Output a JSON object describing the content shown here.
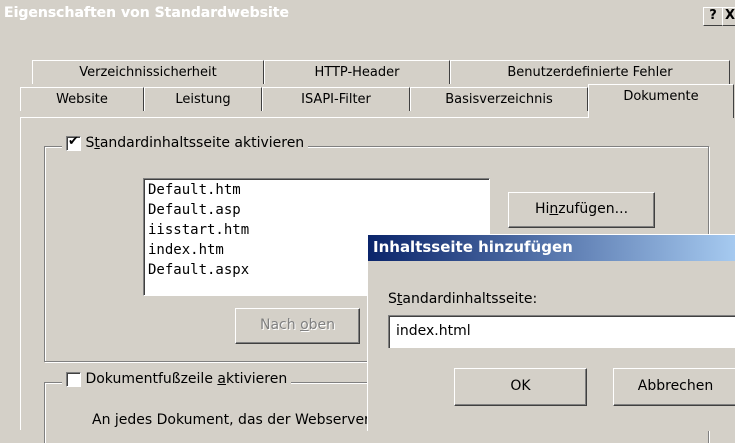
{
  "window": {
    "title": "Eigenschaften von Standardwebsite",
    "help_button": "?",
    "close_button": "X"
  },
  "tabs": {
    "row1": [
      "Verzeichnissicherheit",
      "HTTP-Header",
      "Benutzerdefinierte Fehler"
    ],
    "row2": [
      "Website",
      "Leistung",
      "ISAPI-Filter",
      "Basisverzeichnis",
      "Dokumente"
    ],
    "active": "Dokumente"
  },
  "default_doc": {
    "checkbox_label_pre": "S",
    "checkbox_label_ul": "t",
    "checkbox_label_post": "andardinhaltsseite aktivieren",
    "checked": true,
    "list_items": [
      "Default.htm",
      "Default.asp",
      "iisstart.htm",
      "index.htm",
      "Default.aspx"
    ],
    "add_button_pre": "Hi",
    "add_button_ul": "n",
    "add_button_post": "zufügen...",
    "move_up_pre": "Nach ",
    "move_up_ul": "o",
    "move_up_post": "ben"
  },
  "footer": {
    "checkbox_label_pre": "Dokumentfußzeile ",
    "checkbox_label_ul": "a",
    "checkbox_label_post": "ktivieren",
    "checked": false,
    "description": "An jedes Dokument, das der Webserver zurückgibt, eine"
  },
  "dialog": {
    "title": "Inhaltsseite hinzufügen",
    "label_pre": "S",
    "label_ul": "t",
    "label_post": "andardinhaltsseite:",
    "input_value": "index.html",
    "ok_label": "OK",
    "cancel_label": "Abbrechen"
  },
  "colors": {
    "dialog_title_start": "#0a246a",
    "dialog_title_end": "#a6caf0",
    "face": "#d4d0c8"
  }
}
